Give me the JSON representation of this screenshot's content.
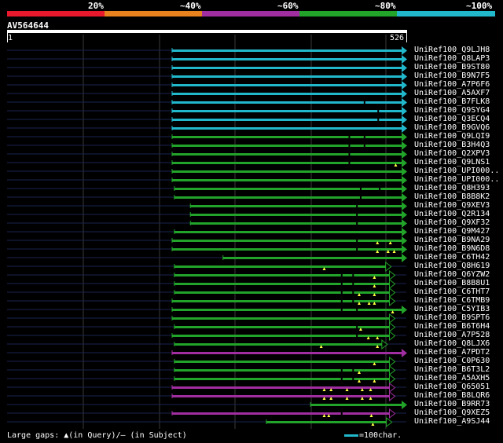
{
  "legend": {
    "labels": [
      "20%",
      "~40%",
      "~60%",
      "~80%",
      "~100%"
    ],
    "colors": [
      "#e8192c",
      "#e8821e",
      "#a12ea0",
      "#22a32a",
      "#22b8cc"
    ]
  },
  "query": {
    "name": "AV564644",
    "start": "1",
    "end": "526",
    "length": 526
  },
  "footer": {
    "gaps_text": "Large gaps: ▲(in Query)/– (in Subject)",
    "scale_text": "=100char."
  },
  "colors": {
    "cyan": "#22b8cc",
    "green": "#22a32a",
    "magenta": "#a12ea0",
    "dotted": "#1c2450",
    "grid": "#3a3a3a",
    "gap": "#000",
    "marker": "#ffff44"
  },
  "hits": [
    {
      "name": "UniRef100_Q9LJH8",
      "color": "cyan",
      "start": 218,
      "end": 526,
      "arrow": "filled",
      "gaps": [],
      "tri": []
    },
    {
      "name": "UniRef100_Q8LAP3",
      "color": "cyan",
      "start": 218,
      "end": 526,
      "arrow": "filled",
      "gaps": [],
      "tri": []
    },
    {
      "name": "UniRef100_B9ST80",
      "color": "cyan",
      "start": 218,
      "end": 526,
      "arrow": "filled",
      "gaps": [],
      "tri": []
    },
    {
      "name": "UniRef100_B9N7F5",
      "color": "cyan",
      "start": 218,
      "end": 526,
      "arrow": "filled",
      "gaps": [],
      "tri": []
    },
    {
      "name": "UniRef100_A7P6F6",
      "color": "cyan",
      "start": 218,
      "end": 526,
      "arrow": "filled",
      "gaps": [],
      "tri": []
    },
    {
      "name": "UniRef100_A5AXF7",
      "color": "cyan",
      "start": 218,
      "end": 526,
      "arrow": "filled",
      "gaps": [],
      "tri": []
    },
    {
      "name": "UniRef100_B7FLK8",
      "color": "cyan",
      "start": 218,
      "end": 526,
      "arrow": "filled",
      "gaps": [
        470
      ],
      "tri": []
    },
    {
      "name": "UniRef100_Q9SYG4",
      "color": "cyan",
      "start": 218,
      "end": 526,
      "arrow": "filled",
      "gaps": [
        488
      ],
      "tri": []
    },
    {
      "name": "UniRef100_Q3ECQ4",
      "color": "cyan",
      "start": 218,
      "end": 526,
      "arrow": "filled",
      "gaps": [
        488
      ],
      "tri": []
    },
    {
      "name": "UniRef100_B9GVQ6",
      "color": "cyan",
      "start": 218,
      "end": 526,
      "arrow": "filled",
      "gaps": [],
      "tri": []
    },
    {
      "name": "UniRef100_Q9LQI9",
      "color": "green",
      "start": 218,
      "end": 526,
      "arrow": "filled",
      "gaps": [
        450,
        470
      ],
      "tri": []
    },
    {
      "name": "UniRef100_B3H4Q3",
      "color": "green",
      "start": 218,
      "end": 526,
      "arrow": "filled",
      "gaps": [
        450,
        470
      ],
      "tri": []
    },
    {
      "name": "UniRef100_Q2XPV3",
      "color": "green",
      "start": 218,
      "end": 526,
      "arrow": "filled",
      "gaps": [
        450
      ],
      "tri": []
    },
    {
      "name": "UniRef100_Q9LNS1",
      "color": "green",
      "start": 218,
      "end": 526,
      "arrow": "filled",
      "gaps": [
        450
      ],
      "tri": [
        512
      ]
    },
    {
      "name": "UniRef100_UPI000..",
      "color": "green",
      "start": 218,
      "end": 526,
      "arrow": "filled",
      "gaps": [],
      "tri": []
    },
    {
      "name": "UniRef100_UPI000..",
      "color": "green",
      "start": 218,
      "end": 526,
      "arrow": "filled",
      "gaps": [],
      "tri": []
    },
    {
      "name": "UniRef100_Q8H393",
      "color": "green",
      "start": 221,
      "end": 526,
      "arrow": "filled",
      "gaps": [
        465,
        490
      ],
      "tri": []
    },
    {
      "name": "UniRef100_B8B8K2",
      "color": "green",
      "start": 221,
      "end": 526,
      "arrow": "filled",
      "gaps": [
        465
      ],
      "tri": []
    },
    {
      "name": "UniRef100_Q9XEV3",
      "color": "green",
      "start": 242,
      "end": 526,
      "arrow": "filled",
      "gaps": [
        460
      ],
      "tri": []
    },
    {
      "name": "UniRef100_Q2R134",
      "color": "green",
      "start": 242,
      "end": 526,
      "arrow": "filled",
      "gaps": [
        460
      ],
      "tri": []
    },
    {
      "name": "UniRef100_Q9XF32",
      "color": "green",
      "start": 242,
      "end": 526,
      "arrow": "filled",
      "gaps": [
        460
      ],
      "tri": []
    },
    {
      "name": "UniRef100_Q9M427",
      "color": "green",
      "start": 221,
      "end": 526,
      "arrow": "filled",
      "gaps": [],
      "tri": []
    },
    {
      "name": "UniRef100_B9NA29",
      "color": "green",
      "start": 218,
      "end": 526,
      "arrow": "filled",
      "gaps": [
        460
      ],
      "tri": [
        488,
        505
      ]
    },
    {
      "name": "UniRef100_B9N6D8",
      "color": "green",
      "start": 218,
      "end": 526,
      "arrow": "filled",
      "gaps": [
        460
      ],
      "tri": [
        488,
        502,
        510
      ]
    },
    {
      "name": "UniRef100_C6TH42",
      "color": "green",
      "start": 285,
      "end": 526,
      "arrow": "filled",
      "gaps": [],
      "tri": []
    },
    {
      "name": "UniRef100_Q8H619",
      "color": "green",
      "start": 221,
      "end": 505,
      "arrow": "open",
      "gaps": [],
      "tri": [
        418
      ]
    },
    {
      "name": "UniRef100_Q6YZW2",
      "color": "green",
      "start": 221,
      "end": 510,
      "arrow": "open",
      "gaps": [
        440,
        455
      ],
      "tri": [
        484
      ]
    },
    {
      "name": "UniRef100_B8B8U1",
      "color": "green",
      "start": 221,
      "end": 510,
      "arrow": "open",
      "gaps": [
        440,
        455
      ],
      "tri": [
        484
      ]
    },
    {
      "name": "UniRef100_C6THT7",
      "color": "green",
      "start": 221,
      "end": 510,
      "arrow": "open",
      "gaps": [
        440,
        455
      ],
      "tri": [
        464,
        484
      ]
    },
    {
      "name": "UniRef100_C6TMB9",
      "color": "green",
      "start": 218,
      "end": 510,
      "arrow": "open",
      "gaps": [
        440,
        455
      ],
      "tri": [
        464,
        477,
        484
      ]
    },
    {
      "name": "UniRef100_C5YIB3",
      "color": "green",
      "start": 218,
      "end": 526,
      "arrow": "filled",
      "gaps": [
        440,
        460
      ],
      "tri": [
        508
      ]
    },
    {
      "name": "UniRef100_B9SPT6",
      "color": "green",
      "start": 218,
      "end": 510,
      "arrow": "open",
      "gaps": [],
      "tri": []
    },
    {
      "name": "UniRef100_B6T6H4",
      "color": "green",
      "start": 221,
      "end": 510,
      "arrow": "open",
      "gaps": [
        460
      ],
      "tri": [
        466
      ]
    },
    {
      "name": "UniRef100_A7P528",
      "color": "green",
      "start": 218,
      "end": 510,
      "arrow": "open",
      "gaps": [
        460
      ],
      "tri": [
        476,
        488
      ]
    },
    {
      "name": "UniRef100_Q8LJX6",
      "color": "green",
      "start": 221,
      "end": 500,
      "arrow": "open",
      "gaps": [],
      "tri": [
        414,
        488
      ]
    },
    {
      "name": "UniRef100_A7PDT2",
      "color": "magenta",
      "start": 218,
      "end": 526,
      "arrow": "filled",
      "gaps": [],
      "tri": []
    },
    {
      "name": "UniRef100_C0P630",
      "color": "green",
      "start": 221,
      "end": 510,
      "arrow": "open",
      "gaps": [],
      "tri": [
        484
      ]
    },
    {
      "name": "UniRef100_B6T3L2",
      "color": "green",
      "start": 221,
      "end": 510,
      "arrow": "open",
      "gaps": [
        440,
        455
      ],
      "tri": [
        464
      ]
    },
    {
      "name": "UniRef100_A5AXH5",
      "color": "green",
      "start": 221,
      "end": 510,
      "arrow": "open",
      "gaps": [
        440,
        455
      ],
      "tri": [
        464,
        484
      ]
    },
    {
      "name": "UniRef100_Q65051",
      "color": "magenta",
      "start": 218,
      "end": 510,
      "arrow": "open",
      "gaps": [],
      "tri": [
        418,
        427,
        448,
        468,
        479
      ]
    },
    {
      "name": "UniRef100_B8LQR6",
      "color": "magenta",
      "start": 218,
      "end": 510,
      "arrow": "open",
      "gaps": [],
      "tri": [
        418,
        427,
        448,
        468,
        479
      ]
    },
    {
      "name": "UniRef100_B9RR73",
      "color": "green",
      "start": 400,
      "end": 526,
      "arrow": "filled",
      "gaps": [],
      "tri": []
    },
    {
      "name": "UniRef100_Q9XEZ5",
      "color": "magenta",
      "start": 218,
      "end": 510,
      "arrow": "open",
      "gaps": [
        440
      ],
      "tri": [
        418,
        424,
        480
      ]
    },
    {
      "name": "UniRef100_A9SJ44",
      "color": "green",
      "start": 342,
      "end": 506,
      "arrow": "open",
      "gaps": [],
      "tri": [
        482
      ]
    }
  ]
}
